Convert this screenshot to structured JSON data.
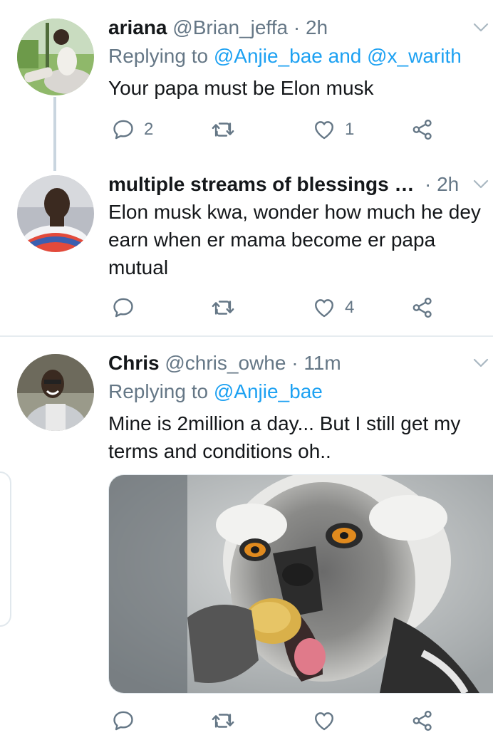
{
  "tweets": [
    {
      "name": "ariana",
      "handle": "@Brian_jeffa",
      "dot": "·",
      "time": "2h",
      "replying_label": "Replying to ",
      "replying_targets": "@Anjie_bae and @x_warith",
      "text": "Your papa must be Elon musk",
      "replies": "2",
      "retweets": "",
      "likes": "1"
    },
    {
      "name": "multiple streams of blessings …",
      "handle": "",
      "dot": "·",
      "time": "2h",
      "text": "Elon musk kwa, wonder how much he dey earn when er mama become er papa mutual",
      "replies": "",
      "retweets": "",
      "likes": "4"
    },
    {
      "name": "Chris",
      "handle": "@chris_owhe",
      "dot": "·",
      "time": "11m",
      "replying_label": "Replying to ",
      "replying_targets": "@Anjie_bae",
      "text": "Mine is 2million a day... But I still get my terms and conditions oh..",
      "replies": "",
      "retweets": "",
      "likes": ""
    }
  ],
  "icons": {
    "reply": "reply-bubble-icon",
    "retweet": "retweet-arrows-icon",
    "like": "heart-icon",
    "share": "share-nodes-icon",
    "menu": "chevron-down-icon"
  },
  "colors": {
    "link": "#1da1f2",
    "secondary_text": "#657786",
    "primary_text": "#14171a",
    "thread_line": "#c9d5df",
    "divider": "#e6ecf0"
  }
}
